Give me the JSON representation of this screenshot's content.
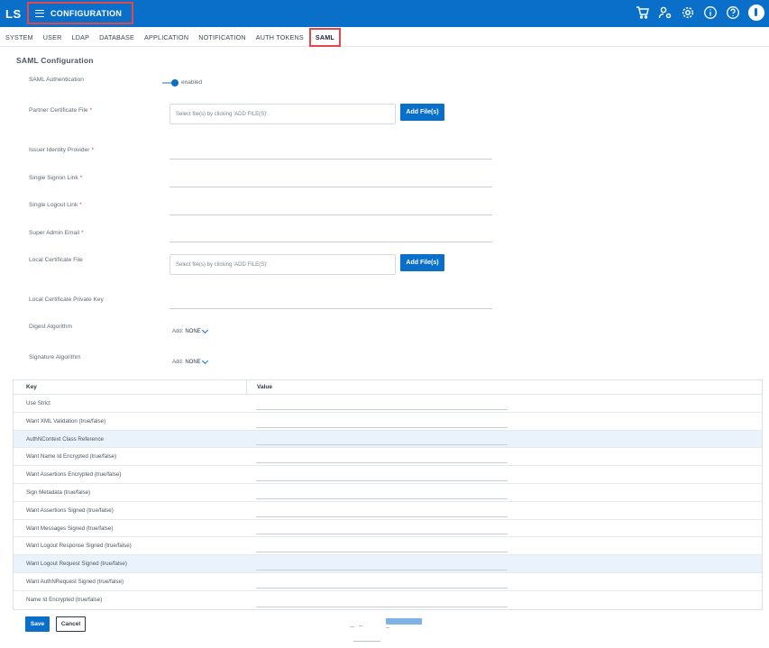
{
  "header": {
    "logo": "LS",
    "title": "CONFIGURATION",
    "icons": [
      "cart-icon",
      "user-settings-icon",
      "gear-icon",
      "info-icon",
      "help-icon",
      "avatar"
    ]
  },
  "tabs": [
    {
      "label": "SYSTEM",
      "active": false
    },
    {
      "label": "USER",
      "active": false
    },
    {
      "label": "LDAP",
      "active": false
    },
    {
      "label": "DATABASE",
      "active": false
    },
    {
      "label": "APPLICATION",
      "active": false
    },
    {
      "label": "NOTIFICATION",
      "active": false
    },
    {
      "label": "AUTH TOKENS",
      "active": false
    },
    {
      "label": "SAML",
      "active": true
    }
  ],
  "section_title": "SAML Configuration",
  "form": {
    "saml_auth_label": "SAML Authentication",
    "saml_auth_state": "enabled",
    "partner_cert_label": "Partner Certificate File",
    "partner_cert_placeholder": "Select file(s) by clicking 'ADD FILE(S)'.",
    "add_files_label": "Add File(s)",
    "issuer_label": "Issuer Identity Provider",
    "sso_label": "Single Signon Link",
    "slo_label": "Single Logout Link",
    "super_admin_label": "Super Admin Email",
    "local_cert_label": "Local Certificate File",
    "local_cert_placeholder": "Select file(s) by clicking 'ADD FILE(S)'.",
    "local_key_label": "Local Certificate Private Key",
    "digest_label": "Digest Algorithm",
    "signature_label": "Signature Algorithm",
    "select_prefix": "Add:",
    "digest_value": "NONE",
    "signature_value": "NONE",
    "required_mark": "*"
  },
  "table": {
    "key_header": "Key",
    "value_header": "Value",
    "rows": [
      {
        "key": "Use Strict",
        "highlight": false
      },
      {
        "key": "Want XML Validation (true/false)",
        "highlight": false
      },
      {
        "key": "AuthNContext Class Reference",
        "highlight": true
      },
      {
        "key": "Want Name Id Encrypted (true/false)",
        "highlight": false
      },
      {
        "key": "Want Assertions Encrypted (true/false)",
        "highlight": false
      },
      {
        "key": "Sign Metadata (true/false)",
        "highlight": false
      },
      {
        "key": "Want Assertions Signed (true/false)",
        "highlight": false
      },
      {
        "key": "Want Messages Signed (true/false)",
        "highlight": false
      },
      {
        "key": "Want Logout Response Signed (true/false)",
        "highlight": false
      },
      {
        "key": "Want Logout Request Signed (true/false)",
        "highlight": true
      },
      {
        "key": "Want AuthNRequest Signed (true/false)",
        "highlight": false
      },
      {
        "key": "Name Id Encrypted (true/false)",
        "highlight": false
      }
    ]
  },
  "footer": {
    "save_label": "Save",
    "cancel_label": "Cancel"
  },
  "colors": {
    "brand": "#0a6fc9",
    "highlight_border": "#e4474b",
    "row_highlight": "#eaf2fb",
    "required": "#e23b3b"
  }
}
